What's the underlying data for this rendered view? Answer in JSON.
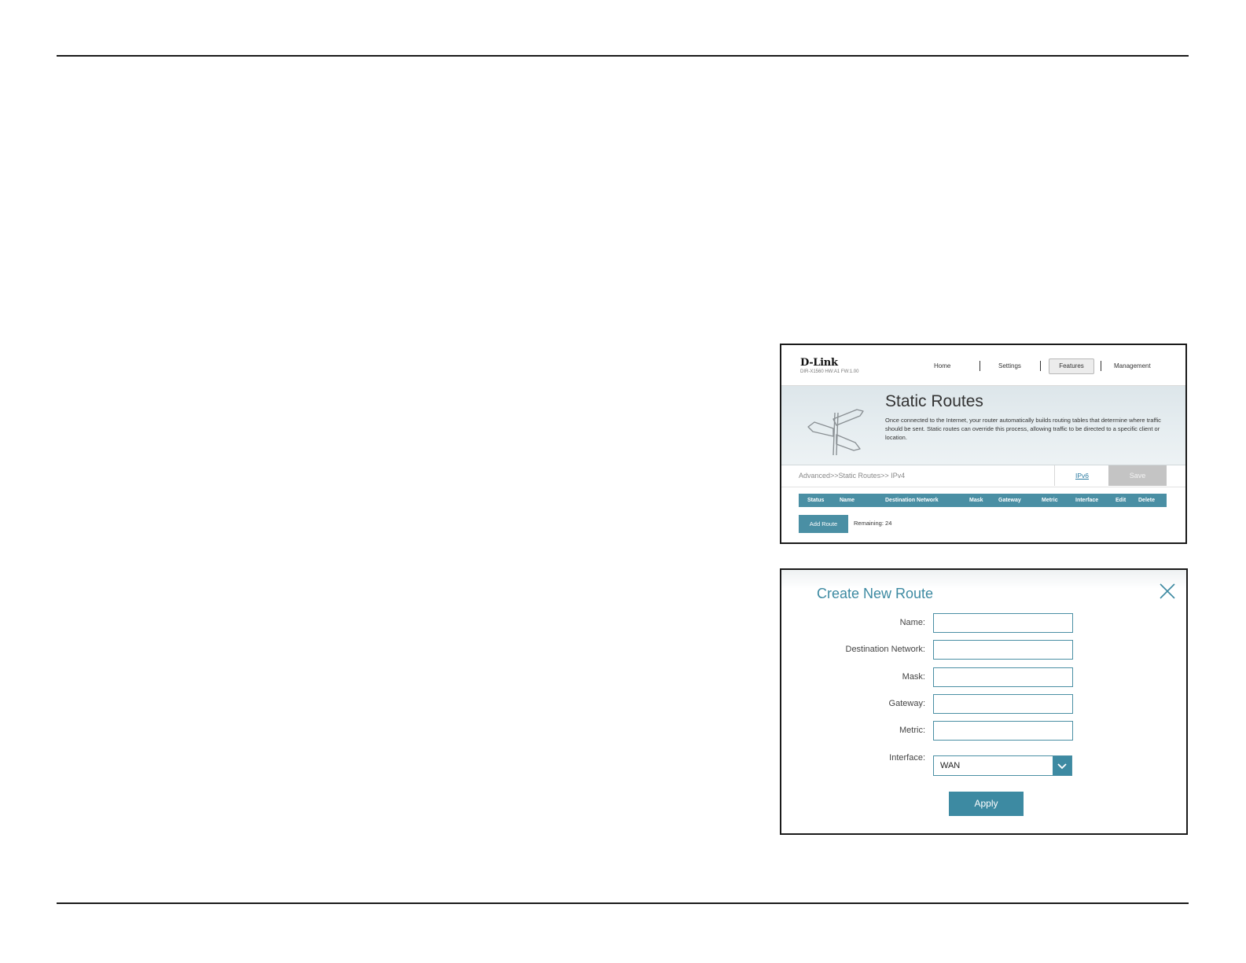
{
  "router_page": {
    "brand": "D-Link",
    "model_info": "DIR-X1560 HW:A1 FW:1.00",
    "nav": {
      "home": "Home",
      "settings": "Settings",
      "features": "Features",
      "management": "Management"
    },
    "banner": {
      "title": "Static Routes",
      "description": "Once connected to the Internet, your router automatically builds routing tables that determine where traffic should be sent. Static routes can override this process, allowing traffic to be directed to a specific client or location."
    },
    "breadcrumb": "Advanced>>Static Routes>> IPv4",
    "ipv6_link": "IPv6",
    "save_label": "Save",
    "table_headers": [
      "Status",
      "Name",
      "Destination Network",
      "Mask",
      "Gateway",
      "Metric",
      "Interface",
      "Edit",
      "Delete"
    ],
    "add_route_label": "Add Route",
    "remaining_text": "Remaining: 24"
  },
  "dialog": {
    "title": "Create New Route",
    "fields": {
      "name_label": "Name:",
      "destination_label": "Destination Network:",
      "mask_label": "Mask:",
      "gateway_label": "Gateway:",
      "metric_label": "Metric:",
      "interface_label": "Interface:"
    },
    "values": {
      "name": "",
      "destination": "",
      "mask": "",
      "gateway": "",
      "metric": ""
    },
    "interface_selected": "WAN",
    "apply_label": "Apply",
    "icons": {
      "close": "close-icon",
      "dropdown": "chevron-down-icon"
    }
  },
  "colors": {
    "accent": "#4a8fa4",
    "dialog_accent": "#3d8aa2",
    "save_disabled": "#c4c4c4",
    "link": "#2a7aa0"
  }
}
